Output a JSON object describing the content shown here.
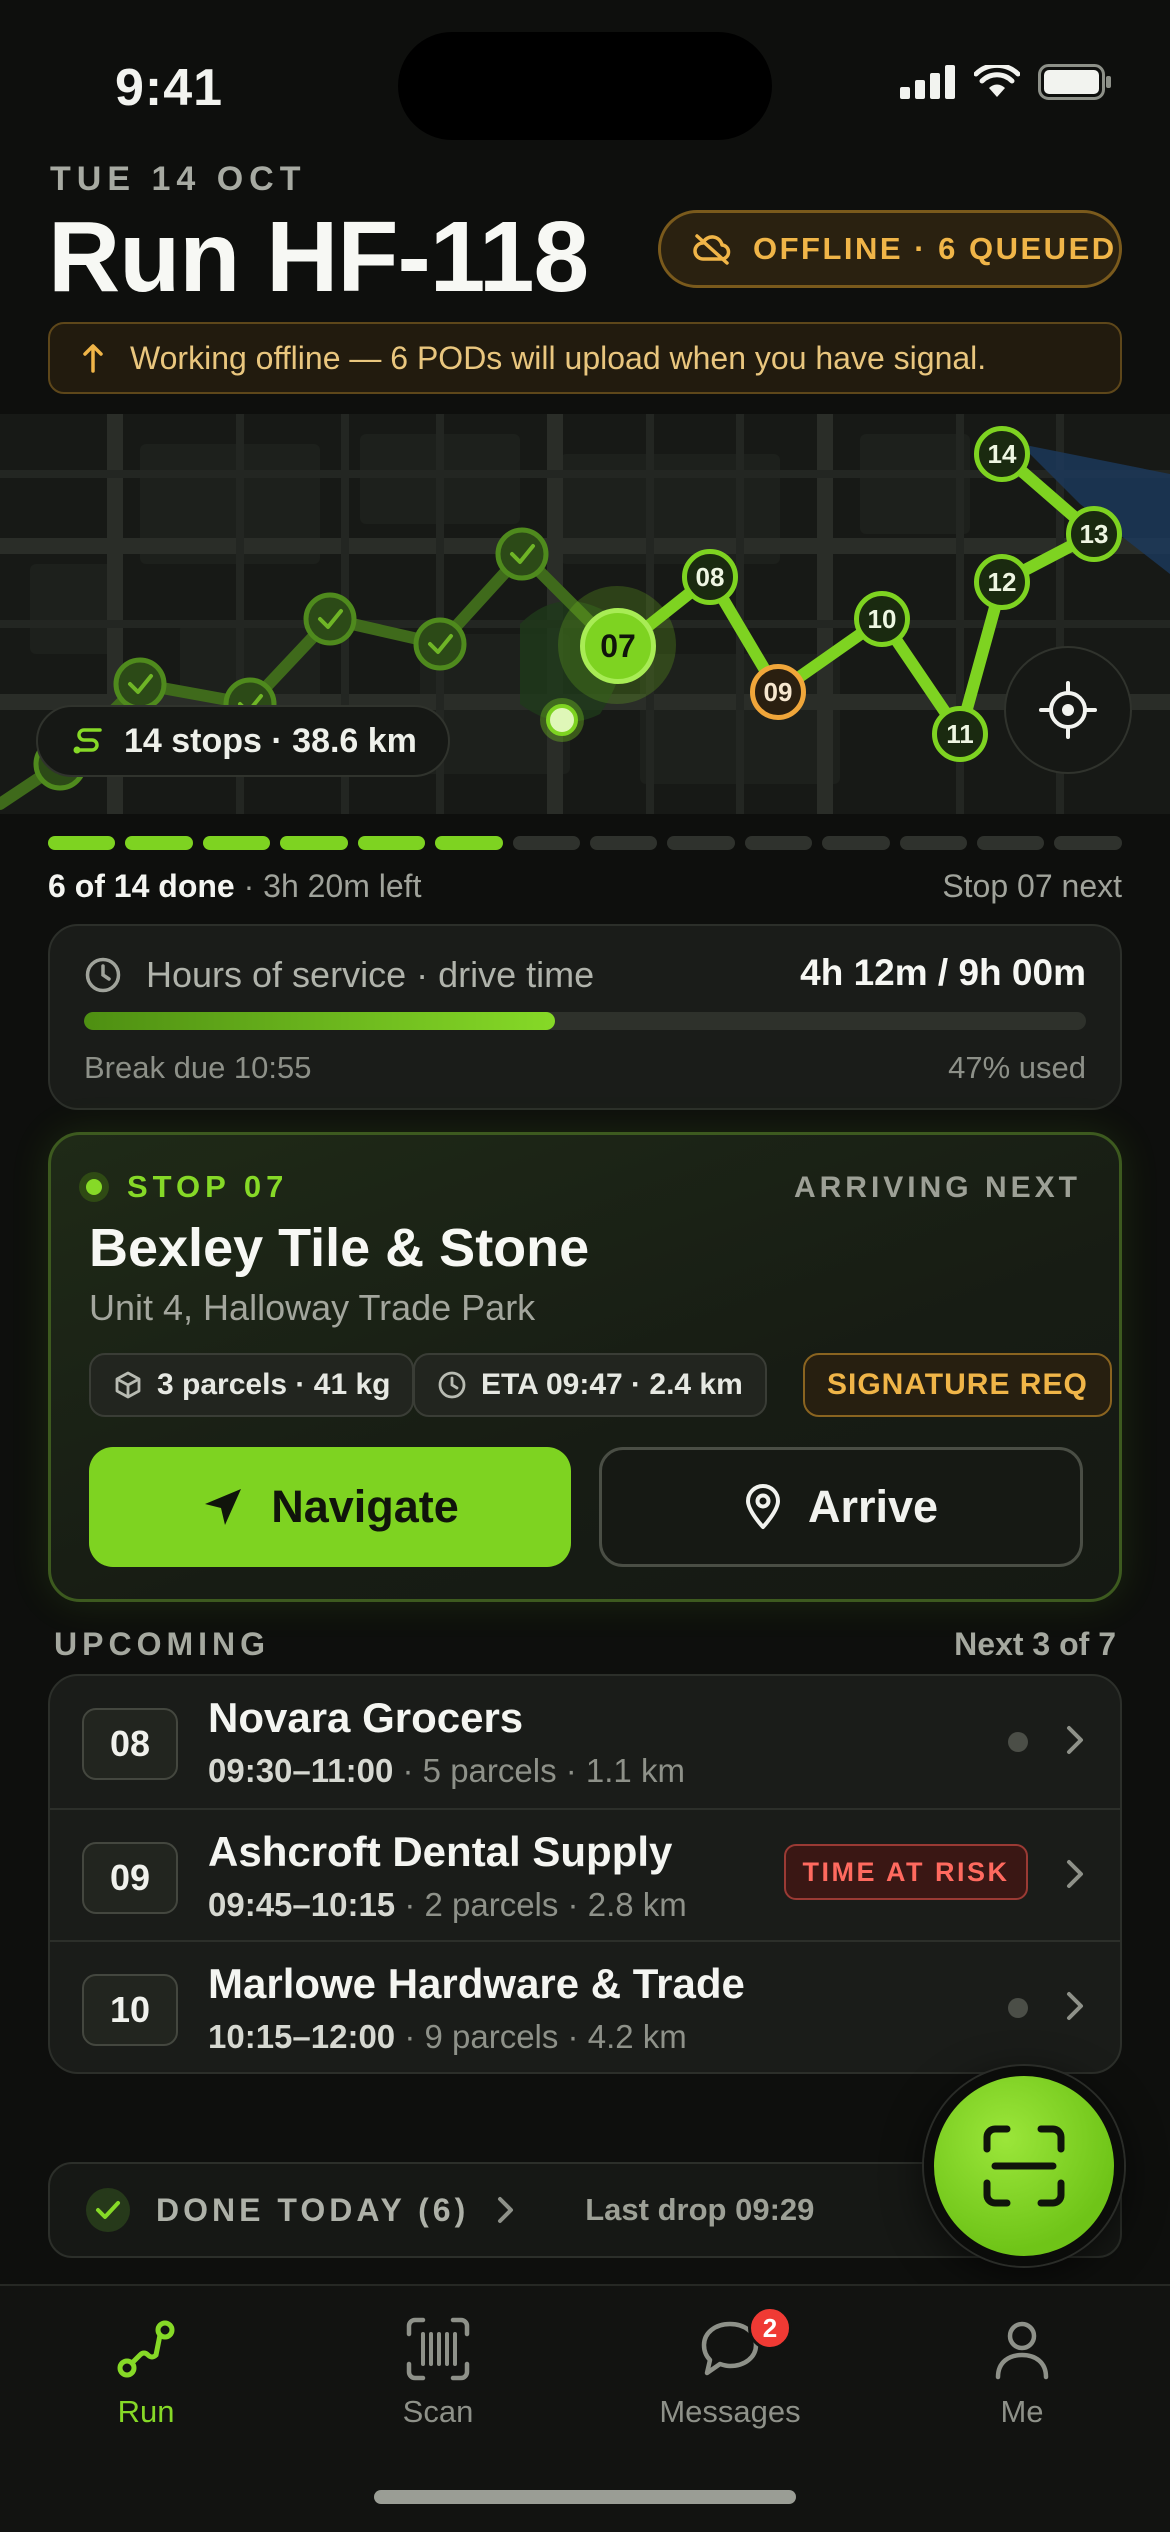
{
  "status_bar": {
    "time": "9:41"
  },
  "header": {
    "date": "TUE 14 OCT",
    "title": "Run HF-118",
    "offline_pill": "OFFLINE · 6 QUEUED",
    "banner": "Working offline — 6 PODs will upload when you have signal."
  },
  "map": {
    "summary": "14 stops · 38.6 km",
    "stops": [
      "07",
      "08",
      "09",
      "10",
      "11",
      "12",
      "13",
      "14"
    ],
    "current_stop": "07",
    "at_risk_stop": "09"
  },
  "progress": {
    "done": 6,
    "total": 14,
    "done_label": "6 of 14 done",
    "time_left": "3h 20m left",
    "next_label": "Stop 07 next"
  },
  "hours": {
    "title": "Hours of service · drive time",
    "value": "4h 12m / 9h 00m",
    "fraction_used": 0.47,
    "break_due": "Break due 10:55",
    "used_label": "47% used"
  },
  "stop_card": {
    "label": "STOP 07",
    "status": "ARRIVING NEXT",
    "name": "Bexley Tile & Stone",
    "address": "Unit 4, Halloway Trade Park",
    "chips": {
      "parcels": "3 parcels · 41 kg",
      "eta": "ETA 09:47 · 2.4 km",
      "signature": "SIGNATURE REQ"
    },
    "navigate_label": "Navigate",
    "arrive_label": "Arrive"
  },
  "upcoming": {
    "title": "UPCOMING",
    "count": "Next 3 of 7",
    "rows": [
      {
        "num": "08",
        "name": "Novara Grocers",
        "window": "09:30–11:00",
        "meta": " · 5 parcels · 1.1 km"
      },
      {
        "num": "09",
        "name": "Ashcroft Dental Supply",
        "window": "09:45–10:15",
        "meta": " · 2 parcels · 2.8 km",
        "badge": "TIME AT RISK"
      },
      {
        "num": "10",
        "name": "Marlowe Hardware & Trade",
        "window": "10:15–12:00",
        "meta": " · 9 parcels · 4.2 km"
      }
    ]
  },
  "done_today": {
    "label": "DONE TODAY (6)",
    "last_drop": "Last drop 09:29"
  },
  "tabs": [
    {
      "label": "Run",
      "icon": "route-icon",
      "active": true
    },
    {
      "label": "Scan",
      "icon": "barcode-icon"
    },
    {
      "label": "Messages",
      "icon": "chat-icon",
      "badge": "2"
    },
    {
      "label": "Me",
      "icon": "person-icon"
    }
  ],
  "colors": {
    "accent": "#7ed321",
    "warning": "#f0b548",
    "danger": "#ff6a5f",
    "background": "#0e0f0d"
  }
}
